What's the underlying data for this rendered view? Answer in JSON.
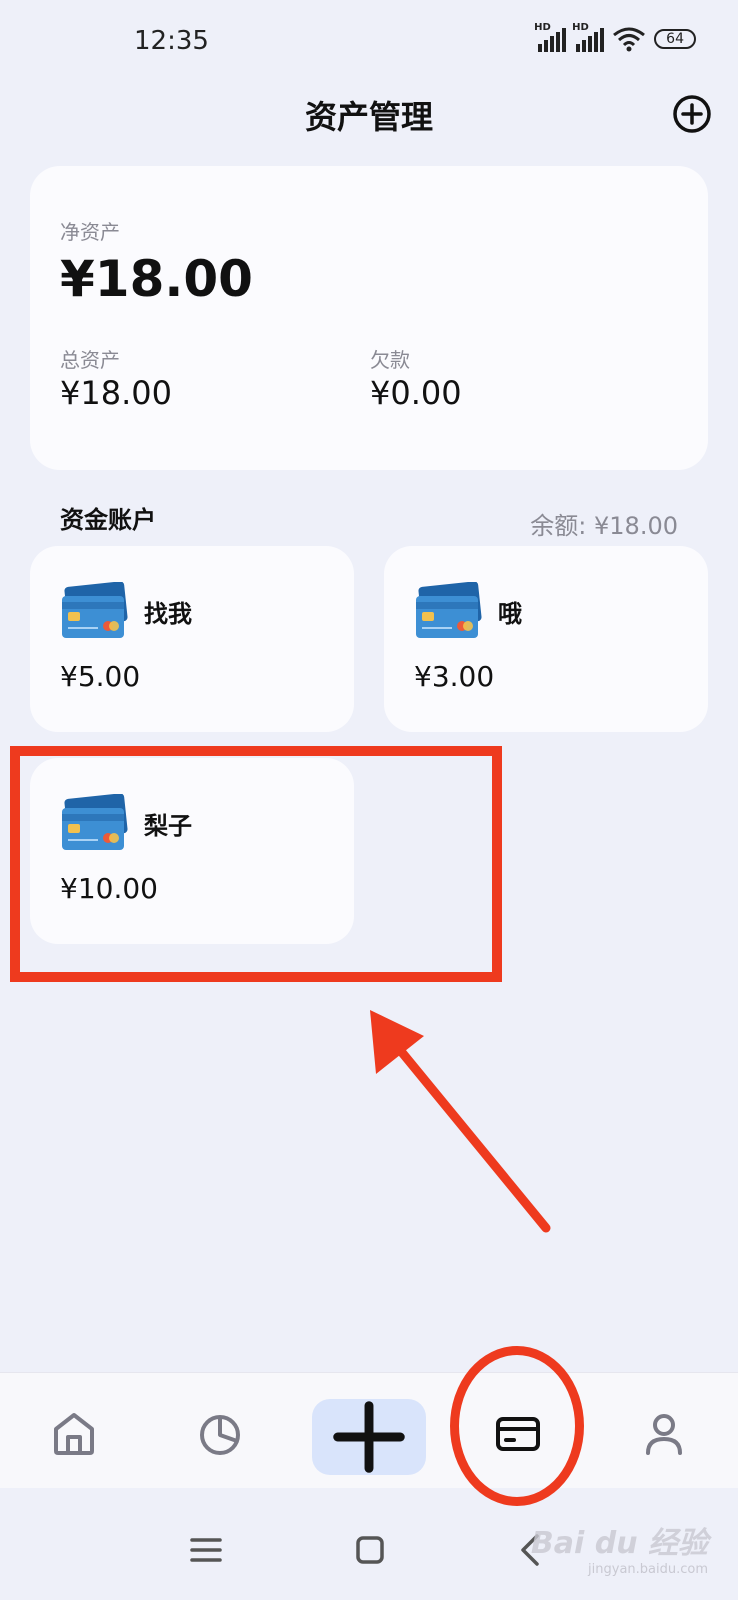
{
  "status_bar": {
    "time": "12:35",
    "signal1_label": "HD",
    "signal2_label": "HD",
    "battery": "64"
  },
  "header": {
    "title": "资产管理",
    "add_icon": "plus-circle-icon"
  },
  "summary": {
    "net_assets_label": "净资产",
    "net_assets_value": "¥18.00",
    "total_assets_label": "总资产",
    "total_assets_value": "¥18.00",
    "debt_label": "欠款",
    "debt_value": "¥0.00"
  },
  "accounts_section": {
    "title": "资金账户",
    "balance_text": "余额: ¥18.00"
  },
  "accounts": [
    {
      "name": "找我",
      "balance": "¥5.00",
      "icon": "credit-card-icon"
    },
    {
      "name": "哦",
      "balance": "¥3.00",
      "icon": "credit-card-icon"
    },
    {
      "name": "梨子",
      "balance": "¥10.00",
      "icon": "credit-card-icon"
    }
  ],
  "bottom_nav": {
    "items": [
      "home-icon",
      "pie-chart-icon",
      "plus-icon",
      "wallet-card-icon",
      "user-icon"
    ],
    "active_color": "#d9e4fb"
  },
  "annotations": {
    "color": "#ee3a1e"
  },
  "watermark": {
    "main": "Bai du 经验",
    "sub": "jingyan.baidu.com"
  }
}
